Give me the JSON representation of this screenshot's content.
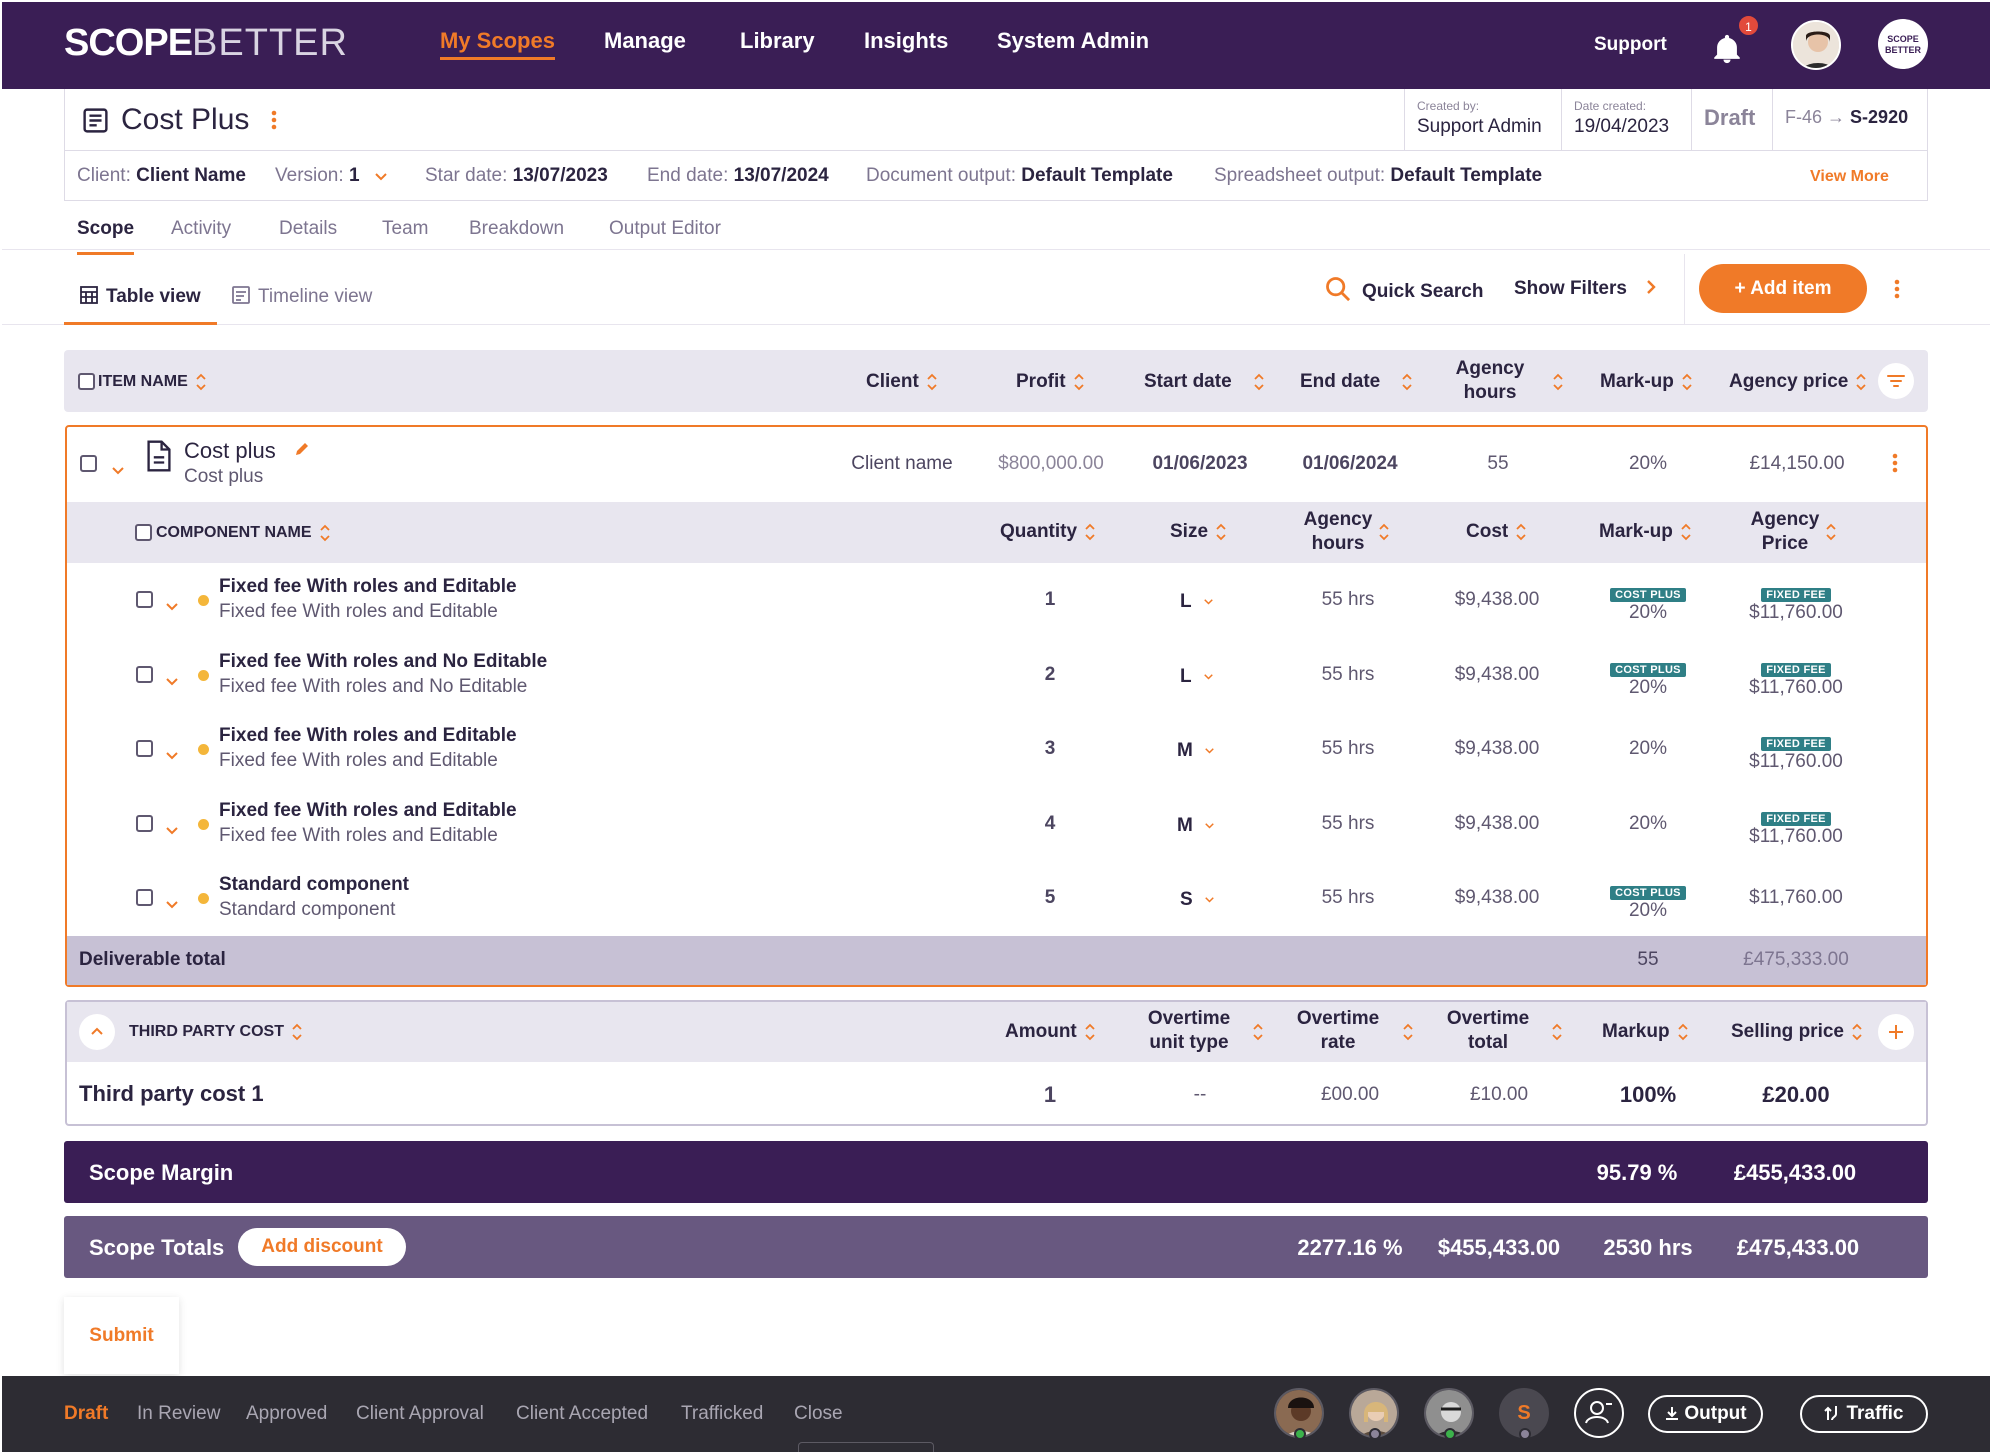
{
  "nav": {
    "logo_a": "SCOPE",
    "logo_b": "BETTER",
    "items": [
      "My Scopes",
      "Manage",
      "Library",
      "Insights",
      "System Admin"
    ],
    "support": "Support",
    "notifications": "1",
    "brand_badge": "SCOPE BETTER"
  },
  "header": {
    "title": "Cost Plus",
    "created_by_label": "Created by:",
    "created_by": "Support Admin",
    "date_created_label": "Date created:",
    "date_created": "19/04/2023",
    "status": "Draft",
    "ref_from": "F-46",
    "ref_arrow": "→",
    "ref_to": "S-2920",
    "client_label": "Client:",
    "client": "Client Name",
    "version_label": "Version:",
    "version": "1",
    "start_label": "Star date:",
    "start": "13/07/2023",
    "end_label": "End date:",
    "end": "13/07/2024",
    "doc_output_label": "Document output:",
    "doc_output": "Default Template",
    "sheet_output_label": "Spreadsheet output:",
    "sheet_output": "Default Template",
    "view_more": "View More"
  },
  "tabs": [
    "Scope",
    "Activity",
    "Details",
    "Team",
    "Breakdown",
    "Output Editor"
  ],
  "views": {
    "table": "Table view",
    "timeline": "Timeline view",
    "quick_search": "Quick Search",
    "show_filters": "Show Filters",
    "add_item": "Add item"
  },
  "table_head": {
    "item_name": "ITEM NAME",
    "client": "Client",
    "profit": "Profit",
    "start": "Start date",
    "end": "End date",
    "hours_1": "Agency",
    "hours_2": "hours",
    "markup": "Mark-up",
    "price": "Agency price"
  },
  "item": {
    "name": "Cost plus",
    "sub": "Cost plus",
    "client": "Client name",
    "profit": "$800,000.00",
    "start": "01/06/2023",
    "end": "01/06/2024",
    "hours": "55",
    "markup": "20%",
    "price": "£14,150.00"
  },
  "comp_head": {
    "name": "COMPONENT NAME",
    "quantity": "Quantity",
    "size": "Size",
    "hours_1": "Agency",
    "hours_2": "hours",
    "cost": "Cost",
    "markup": "Mark-up",
    "price_1": "Agency",
    "price_2": "Price"
  },
  "components": [
    {
      "name": "Fixed fee With roles and Editable",
      "sub": "Fixed fee With roles and Editable",
      "qty": "1",
      "size": "L",
      "hours": "55 hrs",
      "cost": "$9,438.00",
      "markup_tag": "COST PLUS",
      "markup": "20%",
      "price_tag": "FIXED FEE",
      "price": "$11,760.00"
    },
    {
      "name": "Fixed fee With roles and No Editable",
      "sub": "Fixed fee With roles and No Editable",
      "qty": "2",
      "size": "L",
      "hours": "55 hrs",
      "cost": "$9,438.00",
      "markup_tag": "COST PLUS",
      "markup": "20%",
      "price_tag": "FIXED FEE",
      "price": "$11,760.00"
    },
    {
      "name": "Fixed fee With roles and Editable",
      "sub": "Fixed fee With roles and Editable",
      "qty": "3",
      "size": "M",
      "hours": "55 hrs",
      "cost": "$9,438.00",
      "markup_tag": "",
      "markup": "20%",
      "price_tag": "FIXED FEE",
      "price": "$11,760.00"
    },
    {
      "name": "Fixed fee With roles and Editable",
      "sub": "Fixed fee With roles and Editable",
      "qty": "4",
      "size": "M",
      "hours": "55 hrs",
      "cost": "$9,438.00",
      "markup_tag": "",
      "markup": "20%",
      "price_tag": "FIXED FEE",
      "price": "$11,760.00"
    },
    {
      "name": "Standard component",
      "sub": "Standard component",
      "qty": "5",
      "size": "S",
      "hours": "55 hrs",
      "cost": "$9,438.00",
      "markup_tag": "COST PLUS",
      "markup": "20%",
      "price_tag": "",
      "price": "$11,760.00"
    }
  ],
  "deliverable": {
    "label": "Deliverable total",
    "hours": "55",
    "total": "£475,333.00"
  },
  "third_party": {
    "title": "THIRD PARTY COST",
    "amount": "Amount",
    "ot_unit_1": "Overtime",
    "ot_unit_2": "unit type",
    "ot_rate_1": "Overtime",
    "ot_rate_2": "rate",
    "ot_total_1": "Overtime",
    "ot_total_2": "total",
    "markup": "Markup",
    "selling": "Selling price",
    "row": {
      "name": "Third party cost 1",
      "amount": "1",
      "unit": "--",
      "rate": "£00.00",
      "total": "£10.00",
      "markup": "100%",
      "selling": "£20.00"
    }
  },
  "margin": {
    "label": "Scope Margin",
    "pct": "95.79 %",
    "value": "£455,433.00"
  },
  "totals": {
    "label": "Scope Totals",
    "discount": "Add discount",
    "pct": "2277.16 %",
    "value": "$455,433.00",
    "hours": "2530 hrs",
    "total": "£475,433.00"
  },
  "submit": "Submit",
  "stages": [
    "Draft",
    "In Review",
    "Approved",
    "Client Approval",
    "Client Accepted",
    "Trafficked",
    "Close"
  ],
  "bottom": {
    "s_initial": "S",
    "output": "Output",
    "traffic": "Traffic"
  },
  "colors": {
    "primary": "#3a1e55",
    "accent": "#f07a28",
    "secondary_bar": "#685880",
    "tag": "#2f7f86",
    "dot": "#f4b63a"
  }
}
